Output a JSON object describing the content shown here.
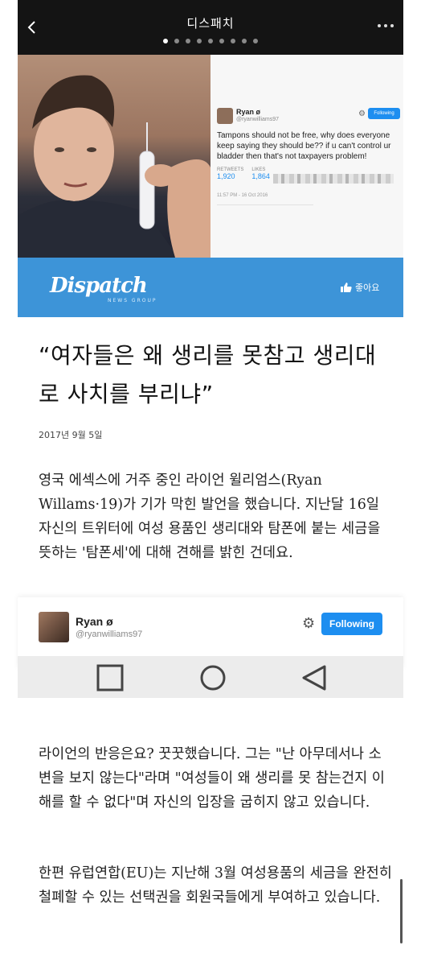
{
  "app_bar": {
    "title": "디스패치",
    "page_dots": 9,
    "active_dot": 0
  },
  "tweet_image": {
    "name": "Ryan ø",
    "handle": "@ryanwilliams97",
    "follow_label": "Following",
    "text": "Tampons should not be free, why does everyone keep saying they should be?? if u can't control ur bladder then that's not taxpayers problem!",
    "retweets_label": "RETWEETS",
    "retweets": "1,920",
    "likes_label": "LIKES",
    "likes": "1,864",
    "time": "11:57 PM - 16 Oct 2016"
  },
  "brand": {
    "logo": "Dispatch",
    "sub": "NEWS GROUP",
    "like_label": "좋아요"
  },
  "article": {
    "headline": "“여자들은 왜 생리를 못참고 생리대로 사치를 부리냐”",
    "date": "2017년 9월 5일",
    "paragraph1": "영국 에섹스에 거주 중인 라이언 윌리엄스(Ryan Willams·19)가 기가 막힌 발언을 했습니다. 지난달 16일 자신의 트위터에 여성 용품인 생리대와 탐폰에 붙는 세금을 뜻하는 '탐폰세'에 대해 견해를 밝힌 건데요.",
    "paragraph2": "라이언의 반응은요? 꿋꿋했습니다. 그는 \"난 아무데서나 소변을 보지 않는다\"라며 \"여성들이 왜 생리를 못 참는건지 이해를 할 수 없다\"며 자신의 입장을 굽히지 않고 있습니다.",
    "paragraph3": "한편 유럽연합(EU)는 지난해 3월 여성용품의 세금을 완전히 철폐할 수 있는 선택권을 회원국들에게 부여하고 있습니다."
  },
  "embed": {
    "name": "Ryan ø",
    "handle": "@ryanwilliams97",
    "follow_label": "Following"
  },
  "colors": {
    "brand_blue": "#3d94d8",
    "twitter_blue": "#1d8ef0",
    "app_bar": "#141414"
  }
}
